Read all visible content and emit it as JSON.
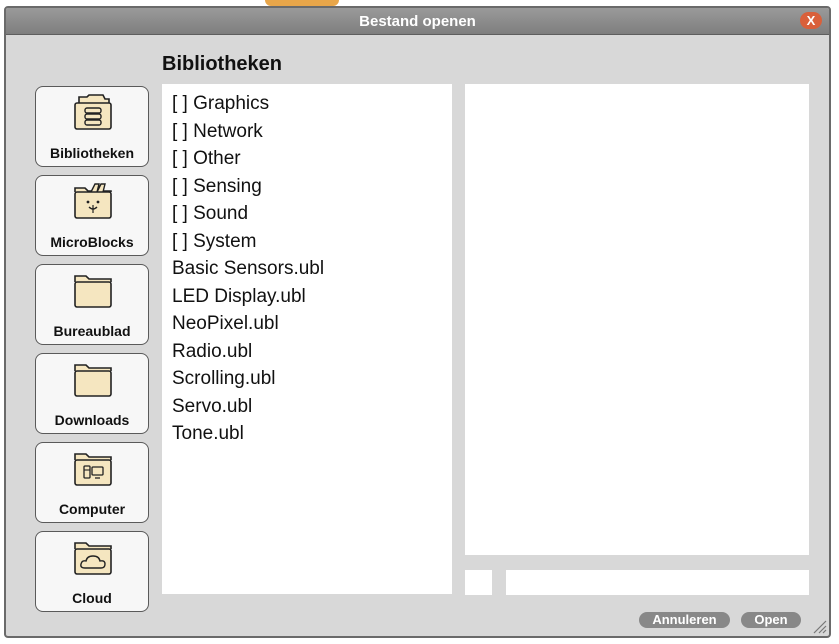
{
  "dialog": {
    "title": "Bestand openen",
    "close_label": "X",
    "heading": "Bibliotheken"
  },
  "locations": [
    {
      "label": "Bibliotheken",
      "icon": "library-icon"
    },
    {
      "label": "MicroBlocks",
      "icon": "microblocks-folder-icon"
    },
    {
      "label": "Bureaublad",
      "icon": "folder-icon"
    },
    {
      "label": "Downloads",
      "icon": "folder-icon"
    },
    {
      "label": "Computer",
      "icon": "computer-folder-icon"
    },
    {
      "label": "Cloud",
      "icon": "cloud-folder-icon"
    }
  ],
  "files": [
    "[ ] Graphics",
    "[ ] Network",
    "[ ] Other",
    "[ ] Sensing",
    "[ ] Sound",
    "[ ] System",
    "Basic Sensors.ubl",
    "LED Display.ubl",
    "NeoPixel.ubl",
    "Radio.ubl",
    "Scrolling.ubl",
    "Servo.ubl",
    "Tone.ubl"
  ],
  "filename_value": "",
  "buttons": {
    "cancel": "Annuleren",
    "open": "Open"
  },
  "colors": {
    "title_bar": "#8a8a8a",
    "close_button": "#d9603b",
    "button_gray": "#888888",
    "folder_fill": "#f5e6c0"
  }
}
